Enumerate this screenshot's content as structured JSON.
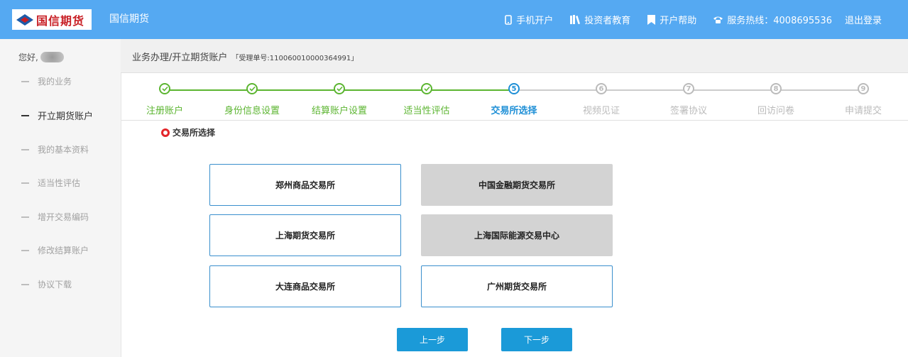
{
  "header": {
    "logo_text": "国信期货",
    "brand": "国信期货",
    "nav": [
      {
        "icon": "phone-icon",
        "label": "手机开户"
      },
      {
        "icon": "books-icon",
        "label": "投资者教育"
      },
      {
        "icon": "bookmark-icon",
        "label": "开户帮助"
      },
      {
        "icon": "telephone-icon",
        "label": "服务热线：4008695536"
      },
      {
        "icon": "",
        "label": "退出登录"
      }
    ]
  },
  "sidebar": {
    "greeting": "您好,",
    "items": [
      {
        "label": "我的业务",
        "active": false
      },
      {
        "label": "开立期货账户",
        "active": true
      },
      {
        "label": "我的基本资料",
        "active": false
      },
      {
        "label": "适当性评估",
        "active": false
      },
      {
        "label": "增开交易编码",
        "active": false
      },
      {
        "label": "修改结算账户",
        "active": false
      },
      {
        "label": "协议下载",
        "active": false
      }
    ]
  },
  "breadcrumb": {
    "path": "业务办理/开立期货账户",
    "ticket": "「受理单号:110060010000364991」"
  },
  "steps": [
    {
      "num": "1",
      "label": "注册账户",
      "status": "done"
    },
    {
      "num": "2",
      "label": "身份信息设置",
      "status": "done"
    },
    {
      "num": "3",
      "label": "结算账户设置",
      "status": "done"
    },
    {
      "num": "4",
      "label": "适当性评估",
      "status": "done"
    },
    {
      "num": "5",
      "label": "交易所选择",
      "status": "current"
    },
    {
      "num": "6",
      "label": "视频见证",
      "status": "pending"
    },
    {
      "num": "7",
      "label": "签署协议",
      "status": "pending"
    },
    {
      "num": "8",
      "label": "回访问卷",
      "status": "pending"
    },
    {
      "num": "9",
      "label": "申请提交",
      "status": "pending"
    }
  ],
  "section_title": "交易所选择",
  "exchanges": [
    {
      "label": "郑州商品交易所",
      "disabled": false
    },
    {
      "label": "中国金融期货交易所",
      "disabled": true
    },
    {
      "label": "上海期货交易所",
      "disabled": false
    },
    {
      "label": "上海国际能源交易中心",
      "disabled": true
    },
    {
      "label": "大连商品交易所",
      "disabled": false
    },
    {
      "label": "广州期货交易所",
      "disabled": false
    }
  ],
  "buttons": {
    "prev": "上一步",
    "next": "下一步"
  },
  "colors": {
    "header": "#55a9f2",
    "done": "#5cb531",
    "current": "#1e8fd6",
    "pending": "#bbbbbb",
    "button": "#1b9ad8",
    "section_dot": "#e3262b"
  }
}
